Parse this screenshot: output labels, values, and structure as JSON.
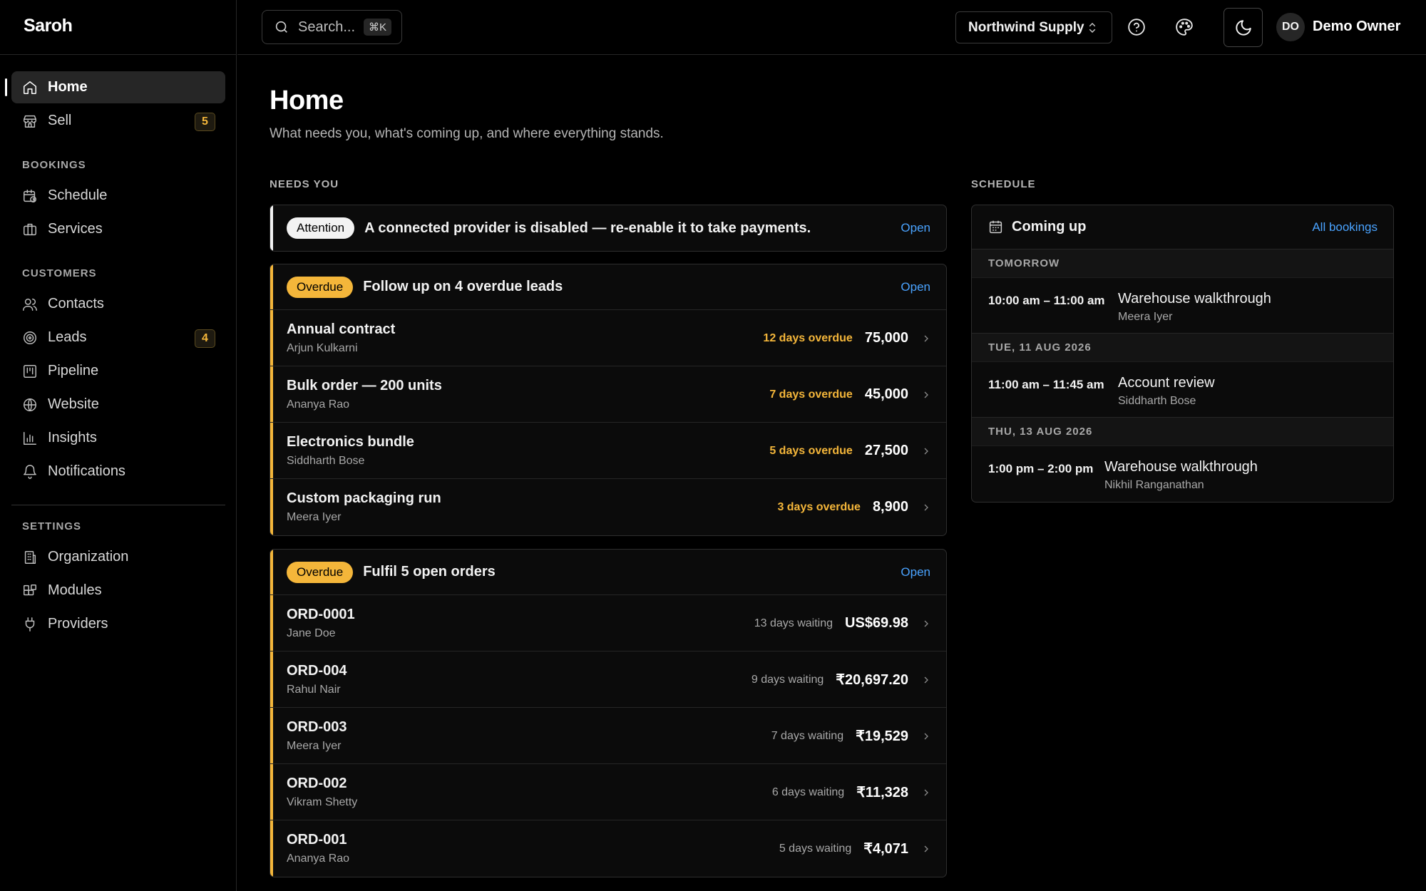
{
  "app": {
    "brand": "Saroh"
  },
  "sidebar": {
    "top_items": [
      {
        "label": "Home",
        "icon": "home-icon",
        "active": true
      },
      {
        "label": "Sell",
        "icon": "store-icon",
        "badge": "5"
      }
    ],
    "sections": [
      {
        "title": "BOOKINGS",
        "items": [
          {
            "label": "Schedule",
            "icon": "calendar-clock-icon"
          },
          {
            "label": "Services",
            "icon": "briefcase-icon"
          }
        ]
      },
      {
        "title": "CUSTOMERS",
        "items": [
          {
            "label": "Contacts",
            "icon": "users-icon"
          },
          {
            "label": "Leads",
            "icon": "target-icon",
            "badge": "4"
          },
          {
            "label": "Pipeline",
            "icon": "kanban-icon"
          },
          {
            "label": "Website",
            "icon": "globe-icon"
          },
          {
            "label": "Insights",
            "icon": "bar-chart-icon"
          },
          {
            "label": "Notifications",
            "icon": "bell-icon"
          }
        ]
      },
      {
        "title": "SETTINGS",
        "items": [
          {
            "label": "Organization",
            "icon": "building-icon"
          },
          {
            "label": "Modules",
            "icon": "blocks-icon"
          },
          {
            "label": "Providers",
            "icon": "plug-icon"
          }
        ]
      }
    ]
  },
  "topbar": {
    "search_placeholder": "Search...",
    "search_shortcut": "⌘K",
    "org_name": "Northwind Supply",
    "avatar_initials": "DO",
    "user_name": "Demo Owner"
  },
  "page": {
    "title": "Home",
    "subtitle": "What needs you, what's coming up, and where everything stands."
  },
  "needs_you": {
    "label": "NEEDS YOU",
    "alert": {
      "pill": "Attention",
      "message": "A connected provider is disabled — re-enable it to take payments.",
      "link": "Open"
    },
    "leads_card": {
      "pill": "Overdue",
      "title": "Follow up on 4 overdue leads",
      "link": "Open",
      "rows": [
        {
          "title": "Annual contract",
          "sub": "Arjun Kulkarni",
          "status": "12 days overdue",
          "amount": "75,000"
        },
        {
          "title": "Bulk order — 200 units",
          "sub": "Ananya Rao",
          "status": "7 days overdue",
          "amount": "45,000"
        },
        {
          "title": "Electronics bundle",
          "sub": "Siddharth Bose",
          "status": "5 days overdue",
          "amount": "27,500"
        },
        {
          "title": "Custom packaging run",
          "sub": "Meera Iyer",
          "status": "3 days overdue",
          "amount": "8,900"
        }
      ]
    },
    "orders_card": {
      "pill": "Overdue",
      "title": "Fulfil 5 open orders",
      "link": "Open",
      "rows": [
        {
          "title": "ORD-0001",
          "sub": "Jane Doe",
          "status": "13 days waiting",
          "amount": "US$69.98"
        },
        {
          "title": "ORD-004",
          "sub": "Rahul Nair",
          "status": "9 days waiting",
          "amount": "₹20,697.20"
        },
        {
          "title": "ORD-003",
          "sub": "Meera Iyer",
          "status": "7 days waiting",
          "amount": "₹19,529"
        },
        {
          "title": "ORD-002",
          "sub": "Vikram Shetty",
          "status": "6 days waiting",
          "amount": "₹11,328"
        },
        {
          "title": "ORD-001",
          "sub": "Ananya Rao",
          "status": "5 days waiting",
          "amount": "₹4,071"
        }
      ]
    }
  },
  "schedule": {
    "label": "SCHEDULE",
    "title": "Coming up",
    "link": "All bookings",
    "days": [
      {
        "label": "TOMORROW",
        "events": [
          {
            "time": "10:00 am – 11:00 am",
            "title": "Warehouse walkthrough",
            "sub": "Meera Iyer"
          }
        ]
      },
      {
        "label": "TUE, 11 AUG 2026",
        "events": [
          {
            "time": "11:00 am – 11:45 am",
            "title": "Account review",
            "sub": "Siddharth Bose"
          }
        ]
      },
      {
        "label": "THU, 13 AUG 2026",
        "events": [
          {
            "time": "1:00 pm – 2:00 pm",
            "title": "Warehouse walkthrough",
            "sub": "Nikhil Ranganathan"
          }
        ]
      }
    ]
  },
  "colors": {
    "accent_link": "#4aa3ff",
    "overdue": "#f4b63a",
    "background": "#000000"
  }
}
